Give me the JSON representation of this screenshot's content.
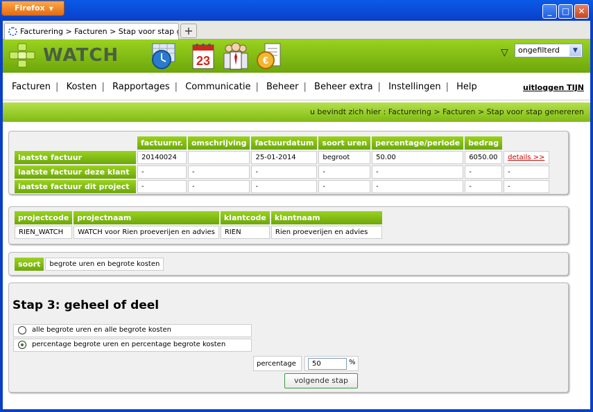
{
  "browser": {
    "menu_label": "Firefox",
    "tab_title": "Facturering > Facturen > Stap voor stap ge...",
    "new_tab_symbol": "+"
  },
  "header": {
    "logo_text": "WATCH",
    "filter_value": "ongefilterd",
    "icons": [
      "clock-icon",
      "calendar-icon",
      "people-icon",
      "euro-invoice-icon"
    ],
    "calendar_day": "23"
  },
  "nav": {
    "items": [
      "Facturen",
      "Kosten",
      "Rapportages",
      "Communicatie",
      "Beheer",
      "Beheer extra",
      "Instellingen",
      "Help"
    ],
    "logout": "uitloggen TIJN"
  },
  "breadcrumb": "u bevindt zich hier : Facturering > Facturen > Stap voor stap genereren",
  "invoice_table": {
    "headers": [
      "factuurnr.",
      "omschrijving",
      "factuurdatum",
      "soort uren",
      "percentage/periode",
      "bedrag"
    ],
    "rows": [
      {
        "label": "laatste factuur",
        "cells": [
          "20140024",
          "",
          "25-01-2014",
          "begroot",
          "50.00",
          "6050.00"
        ],
        "link": "details >>"
      },
      {
        "label": "laatste factuur deze klant",
        "cells": [
          "-",
          "-",
          "-",
          "-",
          "-",
          "-"
        ],
        "link": "-"
      },
      {
        "label": "laatste factuur dit project",
        "cells": [
          "-",
          "-",
          "-",
          "-",
          "-",
          "-"
        ],
        "link": "-"
      }
    ]
  },
  "project_table": {
    "headers": [
      "projectcode",
      "projectnaam",
      "klantcode",
      "klantnaam"
    ],
    "cells": [
      "RIEN_WATCH",
      "WATCH voor Rien proeverijen en advies",
      "RIEN",
      "Rien proeverijen en advies"
    ]
  },
  "soort": {
    "label": "soort",
    "value": "begrote uren en begrote kosten"
  },
  "step": {
    "title": "Stap 3: geheel of deel",
    "option_all": "alle begrote uren en alle begrote kosten",
    "option_pct": "percentage begrote uren en percentage begrote kosten",
    "selected": "percentage",
    "percentage_label": "percentage",
    "percentage_value": "50",
    "percentage_sign": "%",
    "next_button": "volgende stap"
  },
  "colors": {
    "accent": "#7fbb12",
    "dark_accent": "#6da70a",
    "link": "#cc0000"
  }
}
